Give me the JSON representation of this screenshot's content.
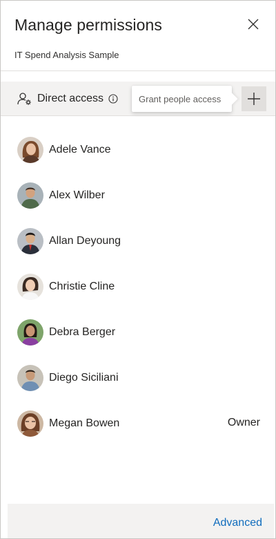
{
  "header": {
    "title": "Manage permissions",
    "subtitle": "IT Spend Analysis Sample",
    "close_icon": "close-icon"
  },
  "toolbar": {
    "access_label": "Direct access",
    "access_icon": "people-settings-icon",
    "info_icon": "info-icon",
    "add_icon": "plus-icon",
    "tooltip": "Grant people access"
  },
  "people": [
    {
      "name": "Adele Vance",
      "role": ""
    },
    {
      "name": "Alex Wilber",
      "role": ""
    },
    {
      "name": "Allan Deyoung",
      "role": ""
    },
    {
      "name": "Christie Cline",
      "role": ""
    },
    {
      "name": "Debra Berger",
      "role": ""
    },
    {
      "name": "Diego Siciliani",
      "role": ""
    },
    {
      "name": "Megan Bowen",
      "role": "Owner"
    }
  ],
  "footer": {
    "advanced_label": "Advanced"
  },
  "colors": {
    "link": "#0f6cbd",
    "toolbar_bg": "#f3f2f1",
    "border": "#e1dfdd"
  }
}
